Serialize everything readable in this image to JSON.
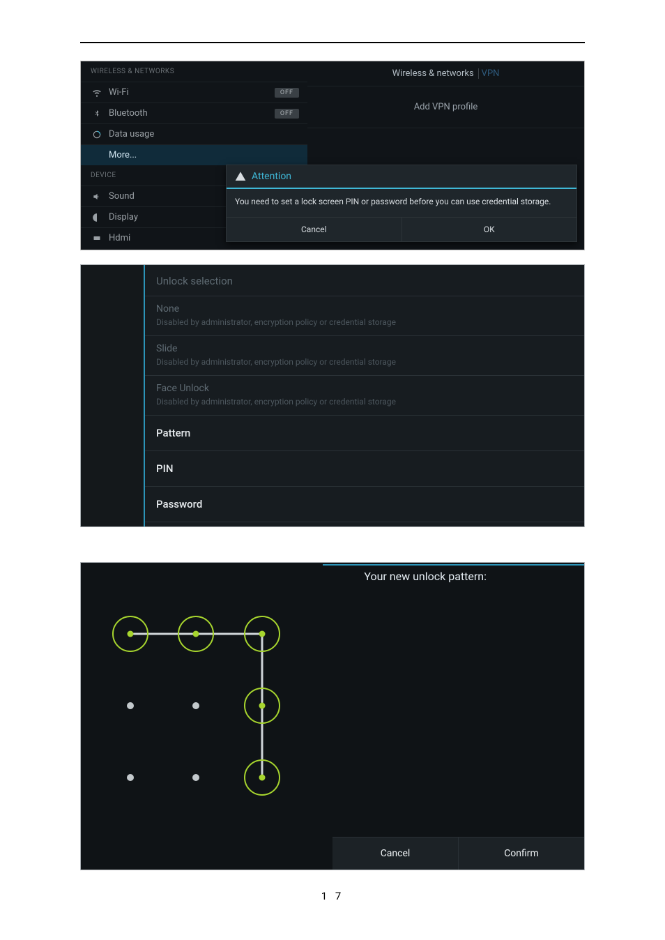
{
  "page_number": "1 7",
  "panel1": {
    "sections": {
      "wireless_label": "WIRELESS & NETWORKS",
      "device_label": "DEVICE"
    },
    "items": {
      "wifi": "Wi-Fi",
      "bluetooth": "Bluetooth",
      "data_usage": "Data usage",
      "more": "More...",
      "sound": "Sound",
      "display": "Display",
      "hdmi": "Hdmi"
    },
    "toggle_off": "OFF",
    "right": {
      "title": "Wireless & networks",
      "title_vpn": "VPN",
      "add_vpn": "Add VPN profile"
    },
    "dialog": {
      "title": "Attention",
      "body": "You need to set a lock screen PIN or password before you can use credential storage.",
      "cancel": "Cancel",
      "ok": "OK"
    }
  },
  "panel2": {
    "header": "Unlock selection",
    "disabled_reason": "Disabled by administrator, encryption policy or credential storage",
    "items": {
      "none": "None",
      "slide": "Slide",
      "face_unlock": "Face Unlock",
      "pattern": "Pattern",
      "pin": "PIN",
      "password": "Password"
    }
  },
  "panel3": {
    "title": "Your new unlock pattern:",
    "cancel": "Cancel",
    "confirm": "Confirm",
    "active_dots": [
      "0-0",
      "0-1",
      "0-2",
      "1-2",
      "2-2"
    ]
  }
}
